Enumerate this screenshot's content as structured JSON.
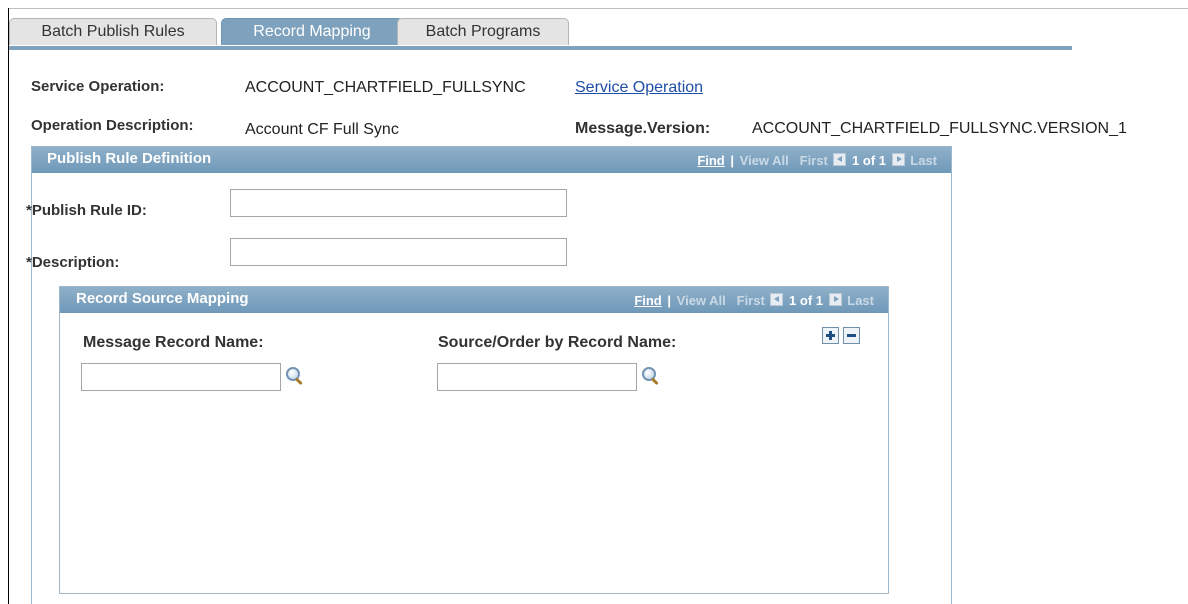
{
  "tabs": [
    {
      "label": "Batch Publish Rules",
      "active": false
    },
    {
      "label": "Record Mapping",
      "active": true
    },
    {
      "label": "Batch Programs",
      "active": false
    }
  ],
  "header": {
    "service_operation_label": "Service Operation:",
    "service_operation_value": "ACCOUNT_CHARTFIELD_FULLSYNC",
    "service_operation_link": "Service Operation",
    "operation_description_label": "Operation Description:",
    "operation_description_value": "Account CF Full Sync",
    "message_version_label": "Message.Version:",
    "message_version_value": "ACCOUNT_CHARTFIELD_FULLSYNC.VERSION_1"
  },
  "publish_rule": {
    "title": "Publish Rule Definition",
    "nav": {
      "find": "Find",
      "view_all": "View All",
      "first": "First",
      "count": "1 of 1",
      "last": "Last"
    },
    "publish_rule_id_label": "*Publish Rule ID:",
    "publish_rule_id_value": "",
    "description_label": "*Description:",
    "description_value": ""
  },
  "record_source": {
    "title": "Record Source Mapping",
    "nav": {
      "find": "Find",
      "view_all": "View All",
      "first": "First",
      "count": "1 of 1",
      "last": "Last"
    },
    "message_record_label": "Message Record Name:",
    "message_record_value": "",
    "source_record_label": "Source/Order by Record Name:",
    "source_record_value": ""
  },
  "icons": {
    "lookup": "magnifier-icon",
    "add_row": "plus-icon",
    "delete_row": "minus-icon",
    "nav_prev": "arrow-left-icon",
    "nav_next": "arrow-right-icon"
  },
  "colors": {
    "accent": "#7ea2be",
    "link": "#1f4ea8"
  }
}
